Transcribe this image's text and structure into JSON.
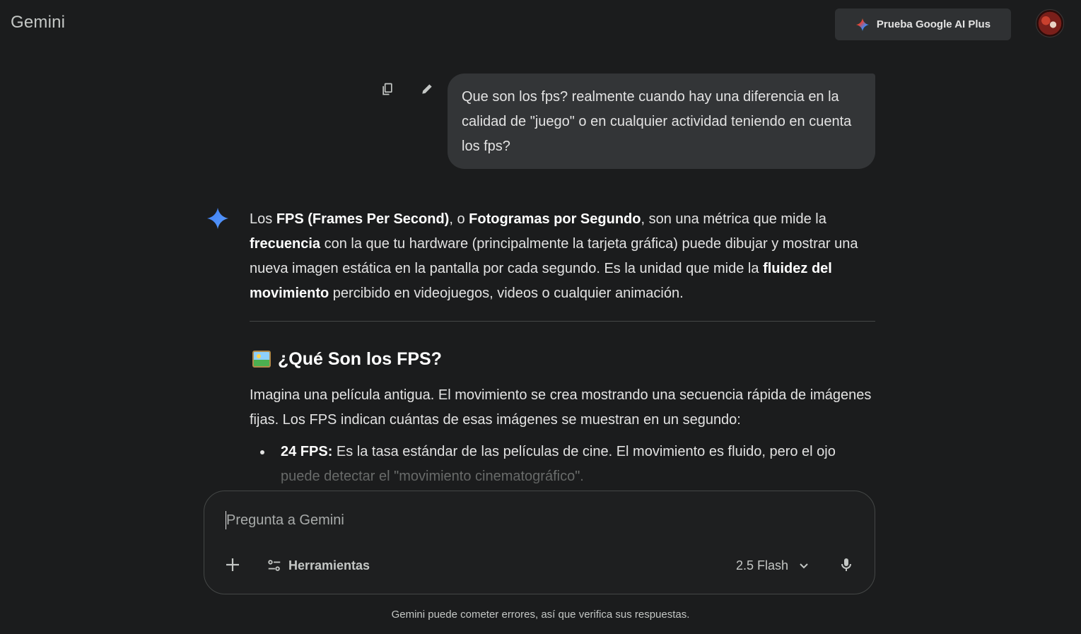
{
  "header": {
    "brand": "Gemini",
    "upgrade_label": "Prueba Google AI Plus"
  },
  "user_message": {
    "text": "Que son los fps? realmente cuando hay una diferencia en la calidad de \"juego\" o en cualquier actividad teniendo en cuenta los fps?"
  },
  "response": {
    "intro": {
      "t1": "Los ",
      "b1": "FPS (Frames Per Second)",
      "t2": ", o ",
      "b2": "Fotogramas por Segundo",
      "t3": ", son una métrica que mide la ",
      "b3": "frecuencia",
      "t4": " con la que tu hardware (principalmente la tarjeta gráfica) puede dibujar y mostrar una nueva imagen estática en la pantalla por cada segundo. Es la unidad que mide la ",
      "b4": "fluidez del movimiento",
      "t5": " percibido en videojuegos, videos o cualquier animación."
    },
    "section_title": "¿Qué Son los FPS?",
    "section_paragraph": "Imagina una película antigua. El movimiento se crea mostrando una secuencia rápida de imágenes fijas. Los FPS indican cuántas de esas imágenes se muestran en un segundo:",
    "bullets": [
      {
        "bold": "24 FPS:",
        "text": " Es la tasa estándar de las películas de cine. El movimiento es fluido, pero el ojo",
        "text_faded": "puede detectar el \"movimiento cinematográfico\"."
      }
    ]
  },
  "composer": {
    "placeholder": "Pregunta a Gemini",
    "tools_label": "Herramientas",
    "model_label": "2.5 Flash"
  },
  "footer": {
    "disclaimer": "Gemini puede cometer errores, así que verifica sus respuestas."
  },
  "colors": {
    "background": "#1b1c1d",
    "bubble": "#333537",
    "spark_blue": "#4a8df8"
  }
}
